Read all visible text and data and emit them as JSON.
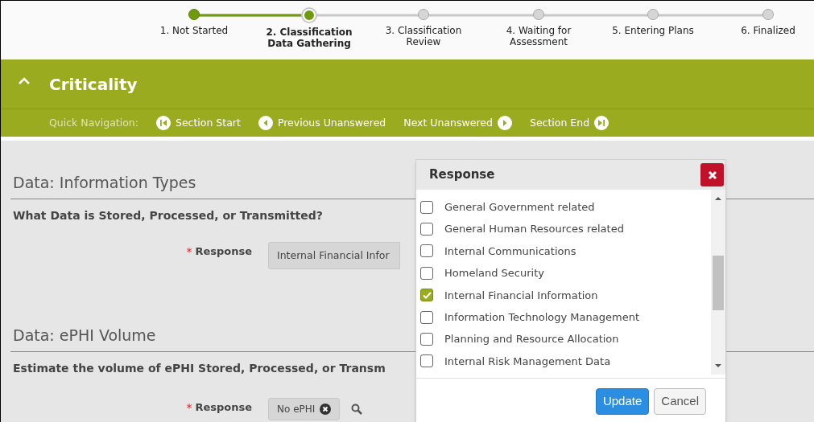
{
  "steps": [
    {
      "number": "1.",
      "label": [
        "Not Started"
      ],
      "completed": true,
      "selected": false
    },
    {
      "number": "2.",
      "label": [
        "Classification",
        "Data Gathering"
      ],
      "completed": true,
      "selected": true
    },
    {
      "number": "3.",
      "label": [
        "Classification",
        "Review"
      ],
      "completed": false,
      "selected": false
    },
    {
      "number": "4.",
      "label": [
        "Waiting for",
        "Assessment"
      ],
      "completed": false,
      "selected": false
    },
    {
      "number": "5.",
      "label": [
        "Entering Plans"
      ],
      "completed": false,
      "selected": false
    },
    {
      "number": "6.",
      "label": [
        "Finalized"
      ],
      "completed": false,
      "selected": false
    }
  ],
  "section": {
    "title": "Criticality",
    "expanded": true
  },
  "quick_nav": {
    "label": "Quick Navigation:",
    "links": [
      {
        "label": "Section Start",
        "kind": "first"
      },
      {
        "label": "Previous Unanswered",
        "kind": "prev"
      },
      {
        "label": "Next Unanswered",
        "kind": "next"
      },
      {
        "label": "Section End",
        "kind": "last"
      }
    ]
  },
  "questions": [
    {
      "heading": "Data: Information Types",
      "question": "What Data is Stored, Processed, or Transmitted?",
      "required_mark": "*",
      "field_label": "Response",
      "value": "Internal Financial Infor",
      "kind": "wide"
    },
    {
      "heading": "Data: ePHI Volume",
      "question": "Estimate the volume of ePHI Stored, Processed, or Transm",
      "required_mark": "*",
      "field_label": "Response",
      "value": "No ePHI",
      "kind": "chip"
    }
  ],
  "dialog": {
    "title": "Response",
    "options": [
      {
        "label": "General Government related",
        "checked": false
      },
      {
        "label": "General Human Resources related",
        "checked": false
      },
      {
        "label": "Internal Communications",
        "checked": false
      },
      {
        "label": "Homeland Security",
        "checked": false
      },
      {
        "label": "Internal Financial Information",
        "checked": true
      },
      {
        "label": "Information Technology Management",
        "checked": false
      },
      {
        "label": "Planning and Resource Allocation",
        "checked": false
      },
      {
        "label": "Internal Risk Management Data",
        "checked": false
      }
    ],
    "buttons": [
      {
        "label": "Update",
        "kind": "primary"
      },
      {
        "label": "Cancel",
        "kind": "secondary"
      }
    ]
  }
}
